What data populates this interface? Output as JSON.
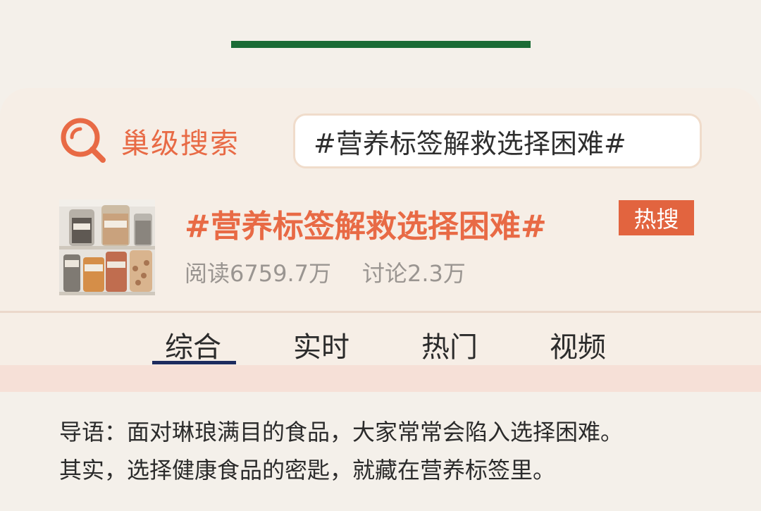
{
  "brand": {
    "name": "巢级搜索",
    "icon": "search-magnifier-icon",
    "accent_color": "#e86a45"
  },
  "search": {
    "value": "#营养标签解救选择困难#"
  },
  "topic": {
    "title": "#营养标签解救选择困难#",
    "badge": "热搜",
    "reads": "阅读6759.7万",
    "discussions": "讨论2.3万",
    "thumbnail": "pantry-jars-photo"
  },
  "tabs": [
    {
      "label": "综合",
      "active": true
    },
    {
      "label": "实时",
      "active": false
    },
    {
      "label": "热门",
      "active": false
    },
    {
      "label": "视频",
      "active": false
    }
  ],
  "intro": {
    "line1": "导语：面对琳琅满目的食品，大家常常会陷入选择困难。",
    "line2": "其实，选择健康食品的密匙，就藏在营养标签里。"
  },
  "colors": {
    "top_bar": "#1a6b35",
    "badge_bg": "#e2643f",
    "tab_underline": "#1d2b5e"
  }
}
